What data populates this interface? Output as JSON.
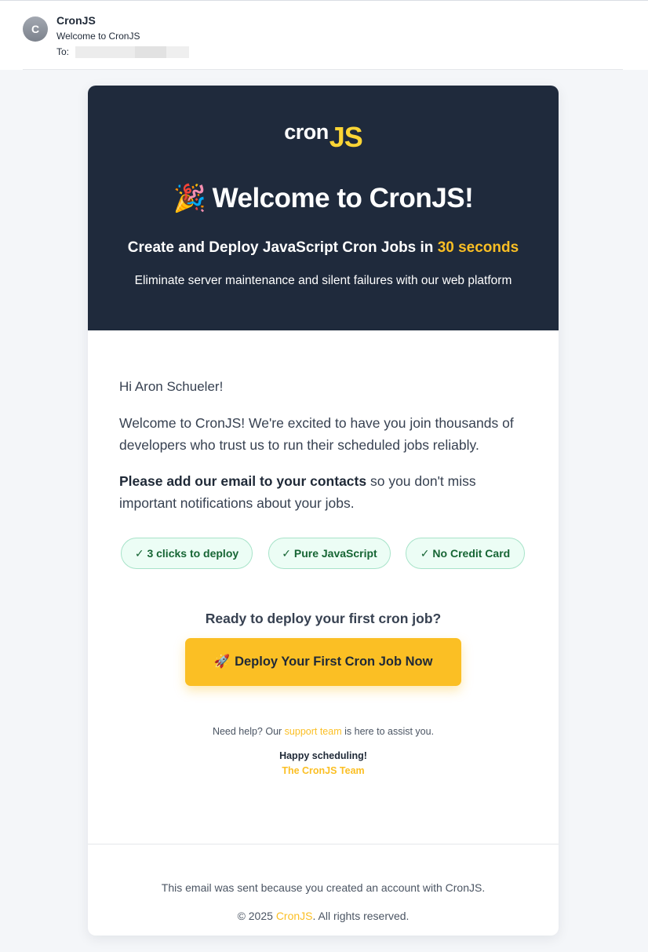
{
  "mail": {
    "avatar_letter": "C",
    "sender": "CronJS",
    "subject": "Welcome to CronJS",
    "to_label": "To:"
  },
  "hero": {
    "logo_cron": "cron",
    "logo_js": "JS",
    "title_emoji": "🎉",
    "title": "Welcome to CronJS!",
    "subtitle_prefix": "Create and Deploy JavaScript Cron Jobs in ",
    "subtitle_highlight": "30 seconds",
    "description": "Eliminate server maintenance and silent failures with our web platform"
  },
  "body": {
    "greeting": "Hi Aron Schueler!",
    "paragraph1": "Welcome to CronJS! We're excited to have you join thousands of developers who trust us to run their scheduled jobs reliably.",
    "paragraph2_bold": "Please add our email to your contacts",
    "paragraph2_rest": " so you don't miss important notifications about your jobs.",
    "badges": [
      "✓ 3 clicks to deploy",
      "✓ Pure JavaScript",
      "✓ No Credit Card"
    ],
    "cta_heading": "Ready to deploy your first cron job?",
    "cta_button_emoji": "🚀",
    "cta_button_label": "Deploy Your First Cron Job Now",
    "help_prefix": "Need help? Our ",
    "help_link": "support team",
    "help_suffix": " is here to assist you.",
    "signoff": "Happy scheduling!",
    "team": "The CronJS Team"
  },
  "footer": {
    "reason": "This email was sent because you created an account with CronJS.",
    "copy_prefix": "© 2025 ",
    "copy_brand": "CronJS",
    "copy_suffix": ". All rights reserved."
  },
  "colors": {
    "hero_bg": "#1f2a3c",
    "accent": "#fbbf24",
    "badge_bg": "#ecfdf5",
    "badge_text": "#166534"
  }
}
